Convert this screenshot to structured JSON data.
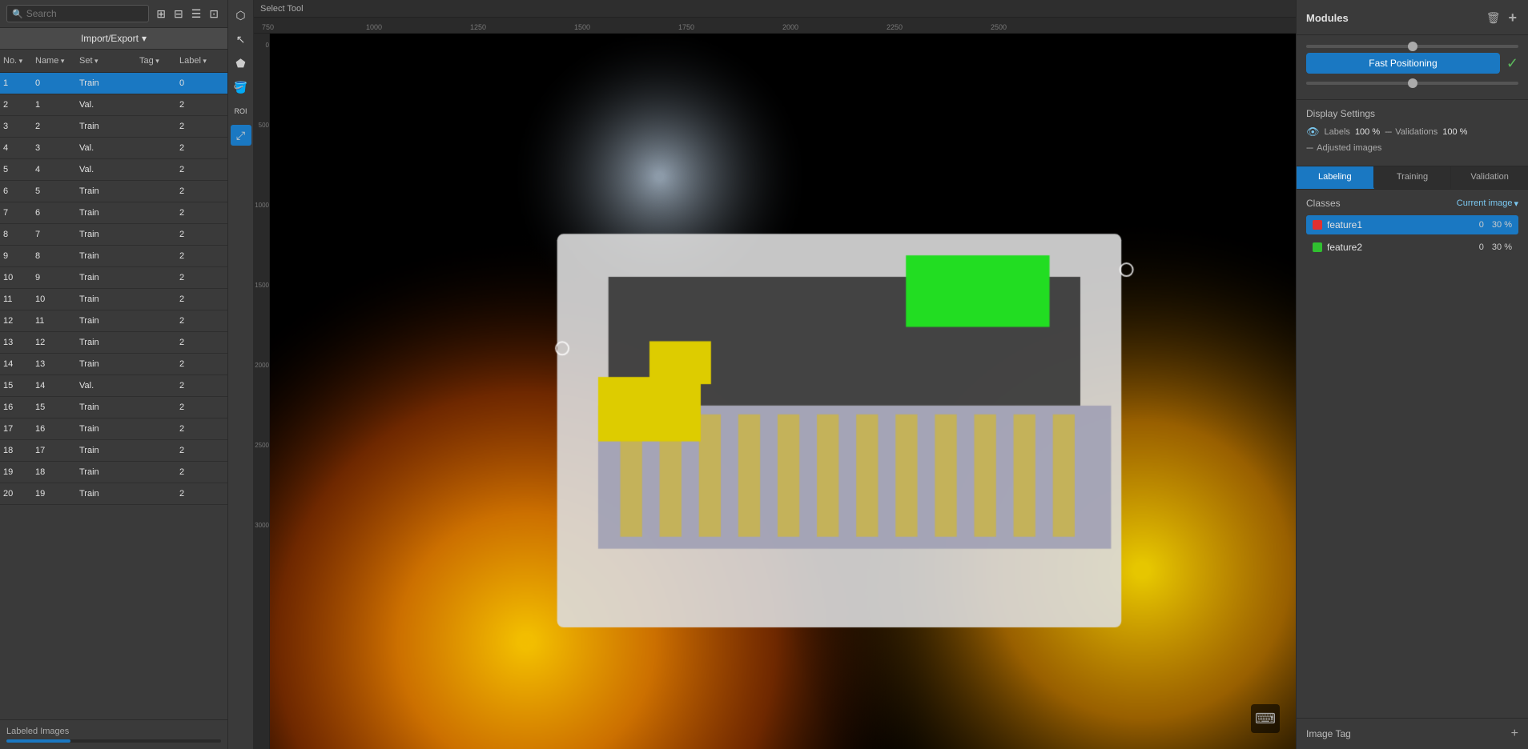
{
  "header": {
    "select_tool_label": "Select Tool"
  },
  "left_panel": {
    "search_placeholder": "Search",
    "import_export_label": "Import/Export",
    "columns": {
      "no": "No.",
      "name": "Name",
      "set": "Set",
      "tag": "Tag",
      "label": "Label"
    },
    "rows": [
      {
        "no": 1,
        "name": "0",
        "set": "Train",
        "tag": "",
        "label": "0",
        "selected": true
      },
      {
        "no": 2,
        "name": "1",
        "set": "Val.",
        "tag": "",
        "label": "2"
      },
      {
        "no": 3,
        "name": "2",
        "set": "Train",
        "tag": "",
        "label": "2"
      },
      {
        "no": 4,
        "name": "3",
        "set": "Val.",
        "tag": "",
        "label": "2"
      },
      {
        "no": 5,
        "name": "4",
        "set": "Val.",
        "tag": "",
        "label": "2"
      },
      {
        "no": 6,
        "name": "5",
        "set": "Train",
        "tag": "",
        "label": "2"
      },
      {
        "no": 7,
        "name": "6",
        "set": "Train",
        "tag": "",
        "label": "2"
      },
      {
        "no": 8,
        "name": "7",
        "set": "Train",
        "tag": "",
        "label": "2"
      },
      {
        "no": 9,
        "name": "8",
        "set": "Train",
        "tag": "",
        "label": "2"
      },
      {
        "no": 10,
        "name": "9",
        "set": "Train",
        "tag": "",
        "label": "2"
      },
      {
        "no": 11,
        "name": "10",
        "set": "Train",
        "tag": "",
        "label": "2"
      },
      {
        "no": 12,
        "name": "11",
        "set": "Train",
        "tag": "",
        "label": "2"
      },
      {
        "no": 13,
        "name": "12",
        "set": "Train",
        "tag": "",
        "label": "2"
      },
      {
        "no": 14,
        "name": "13",
        "set": "Train",
        "tag": "",
        "label": "2"
      },
      {
        "no": 15,
        "name": "14",
        "set": "Val.",
        "tag": "",
        "label": "2"
      },
      {
        "no": 16,
        "name": "15",
        "set": "Train",
        "tag": "",
        "label": "2"
      },
      {
        "no": 17,
        "name": "16",
        "set": "Train",
        "tag": "",
        "label": "2"
      },
      {
        "no": 18,
        "name": "17",
        "set": "Train",
        "tag": "",
        "label": "2"
      },
      {
        "no": 19,
        "name": "18",
        "set": "Train",
        "tag": "",
        "label": "2"
      },
      {
        "no": 20,
        "name": "19",
        "set": "Train",
        "tag": "",
        "label": "2"
      }
    ],
    "labeled_images_label": "Labeled Images",
    "progress_label": "4/20"
  },
  "tools": [
    {
      "name": "select-tool",
      "icon": "⬡",
      "active": false
    },
    {
      "name": "pointer-tool",
      "icon": "↖",
      "active": false
    },
    {
      "name": "polygon-tool",
      "icon": "⬟",
      "active": false
    },
    {
      "name": "paint-tool",
      "icon": "🪣",
      "active": false
    },
    {
      "name": "roi-tool",
      "icon": "ROI",
      "active": false
    },
    {
      "name": "transform-tool",
      "icon": "⤢",
      "active": true
    }
  ],
  "right_panel": {
    "title": "Modules",
    "delete_label": "🗑",
    "add_label": "+",
    "fast_positioning_label": "Fast Positioning",
    "checkmark_label": "✓",
    "display_settings": {
      "title": "Display Settings",
      "labels_label": "Labels",
      "labels_value": "100 %",
      "validations_label": "Validations",
      "validations_value": "100 %",
      "adjusted_images_label": "Adjusted images"
    },
    "tabs": [
      {
        "id": "labeling",
        "label": "Labeling",
        "active": true
      },
      {
        "id": "training",
        "label": "Training",
        "active": false
      },
      {
        "id": "validation",
        "label": "Validation",
        "active": false
      }
    ],
    "classes": {
      "title": "Classes",
      "dropdown_label": "Current image",
      "items": [
        {
          "name": "feature1",
          "color": "#e03030",
          "count": "0",
          "pct": "30 %",
          "active": true
        },
        {
          "name": "feature2",
          "color": "#30c030",
          "count": "0",
          "pct": "30 %",
          "active": false
        }
      ]
    },
    "image_tag": {
      "label": "Image Tag",
      "add_label": "+"
    }
  },
  "colors": {
    "accent_blue": "#1a78c2",
    "selected_blue": "#1a78c2",
    "feature1_red": "#e03030",
    "feature2_green": "#30c030"
  }
}
